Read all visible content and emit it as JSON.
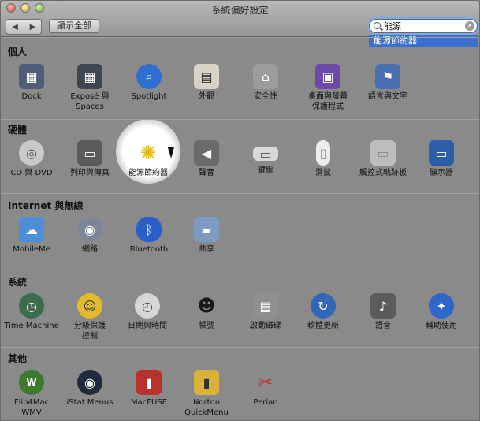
{
  "window": {
    "title": "系統偏好設定"
  },
  "toolbar": {
    "back_symbol": "◀",
    "forward_symbol": "▶",
    "show_all_label": "顯示全部"
  },
  "search": {
    "value": "能源",
    "clear_symbol": "✕",
    "result": "能源節約器"
  },
  "sections": [
    {
      "title": "個人",
      "items": [
        {
          "label": "Dock"
        },
        {
          "label": "Exposé 與\nSpaces"
        },
        {
          "label": "Spotlight"
        },
        {
          "label": "外觀"
        },
        {
          "label": "安全性"
        },
        {
          "label": "桌面與螢幕\n保護程式"
        },
        {
          "label": "語言與文字"
        }
      ]
    },
    {
      "title": "硬體",
      "items": [
        {
          "label": "CD 與 DVD"
        },
        {
          "label": "列印與傳真"
        },
        {
          "label": "能源節約器"
        },
        {
          "label": "聲音"
        },
        {
          "label": "鍵盤"
        },
        {
          "label": "滑鼠"
        },
        {
          "label": "觸控式軌跡板"
        },
        {
          "label": "顯示器"
        }
      ]
    },
    {
      "title": "Internet 與無線",
      "items": [
        {
          "label": "MobileMe"
        },
        {
          "label": "網路"
        },
        {
          "label": "Bluetooth"
        },
        {
          "label": "共享"
        }
      ]
    },
    {
      "title": "系統",
      "items": [
        {
          "label": "Time Machine"
        },
        {
          "label": "分級保護\n控制"
        },
        {
          "label": "日期與時間"
        },
        {
          "label": "帳號"
        },
        {
          "label": "啟動磁碟"
        },
        {
          "label": "軟體更新"
        },
        {
          "label": "語音"
        },
        {
          "label": "輔助使用"
        }
      ]
    },
    {
      "title": "其他",
      "items": [
        {
          "label": "Flip4Mac\nWMV"
        },
        {
          "label": "iStat Menus"
        },
        {
          "label": "MacFUSE"
        },
        {
          "label": "Norton\nQuickMenu"
        },
        {
          "label": "Perian"
        }
      ]
    }
  ],
  "icon_glyphs": {
    "dock": "▦",
    "expose": "▦",
    "spotlight": "⌕",
    "appearance": "▤",
    "security": "⌂",
    "desktop": "▣",
    "language": "⚑",
    "cd": "◎",
    "print": "▭",
    "energy": "✺",
    "sound": "◀",
    "keyboard": "▭",
    "mouse": "▯",
    "trackpad": "▭",
    "display": "▭",
    "mobileme": "☁",
    "network": "◉",
    "bluetooth": "ᛒ",
    "sharing": "▰",
    "timemachine": "◷",
    "parental": "☺",
    "datetime": "◴",
    "accounts": "☻",
    "startup": "▤",
    "update": "↻",
    "speech": "♪",
    "universal": "✦",
    "flip4mac": "W",
    "istat": "◉",
    "macfuse": "▮",
    "norton": "▮",
    "perian": "✂"
  },
  "colors": {
    "accent": "#3b6fd0",
    "highlight_glow": "#ffffff"
  }
}
